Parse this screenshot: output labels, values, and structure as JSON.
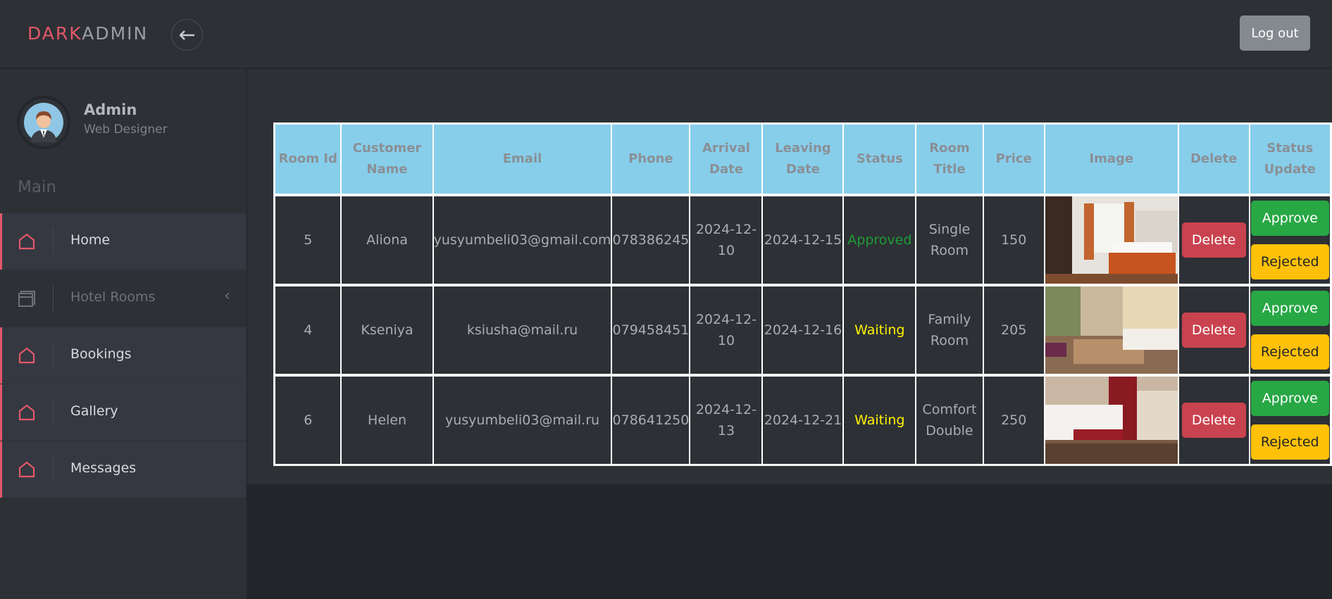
{
  "header": {
    "logo_part1": "DARK",
    "logo_part2": "ADMIN",
    "toggle_icon": "arrow-left-icon",
    "logout_label": "Log out"
  },
  "sidebar": {
    "profile": {
      "name": "Admin",
      "role": "Web Designer"
    },
    "section_title": "Main",
    "items": [
      {
        "label": "Home",
        "icon": "home-icon",
        "active": true
      },
      {
        "label": "Hotel Rooms",
        "icon": "rooms-icon",
        "active": false,
        "has_chevron": true
      },
      {
        "label": "Bookings",
        "icon": "home-icon",
        "active": true
      },
      {
        "label": "Gallery",
        "icon": "home-icon",
        "active": true
      },
      {
        "label": "Messages",
        "icon": "home-icon",
        "active": true
      }
    ],
    "chevron": "‹"
  },
  "table": {
    "headers": [
      "Room Id",
      "Customer Name",
      "Email",
      "Phone",
      "Arrival Date",
      "Leaving Date",
      "Status",
      "Room Title",
      "Price",
      "Image",
      "Delete",
      "Status Update"
    ],
    "rows": [
      {
        "id": "5",
        "name": "Aliona",
        "email": "yusyumbeli03@gmail.com",
        "phone": "078386245",
        "arrival": "2024-12-10",
        "leaving": "2024-12-15",
        "status": "Approved",
        "title": "Single Room",
        "price": "150"
      },
      {
        "id": "4",
        "name": "Kseniya",
        "email": "ksiusha@mail.ru",
        "phone": "079458451",
        "arrival": "2024-12-10",
        "leaving": "2024-12-16",
        "status": "Waiting",
        "title": "Family Room",
        "price": "205"
      },
      {
        "id": "6",
        "name": "Helen",
        "email": "yusyumbeli03@mail.ru",
        "phone": "078641250",
        "arrival": "2024-12-13",
        "leaving": "2024-12-21",
        "status": "Waiting",
        "title": "Comfort Double",
        "price": "250"
      }
    ],
    "buttons": {
      "delete": "Delete",
      "approve": "Approve",
      "rejected": "Rejected"
    }
  },
  "colors": {
    "accent": "#e3586a",
    "header_bg": "#87ceeb",
    "approved": "#1f9d36",
    "waiting": "#fff200",
    "delete": "#c9424f",
    "approve": "#28a745",
    "rejected": "#ffc107"
  }
}
